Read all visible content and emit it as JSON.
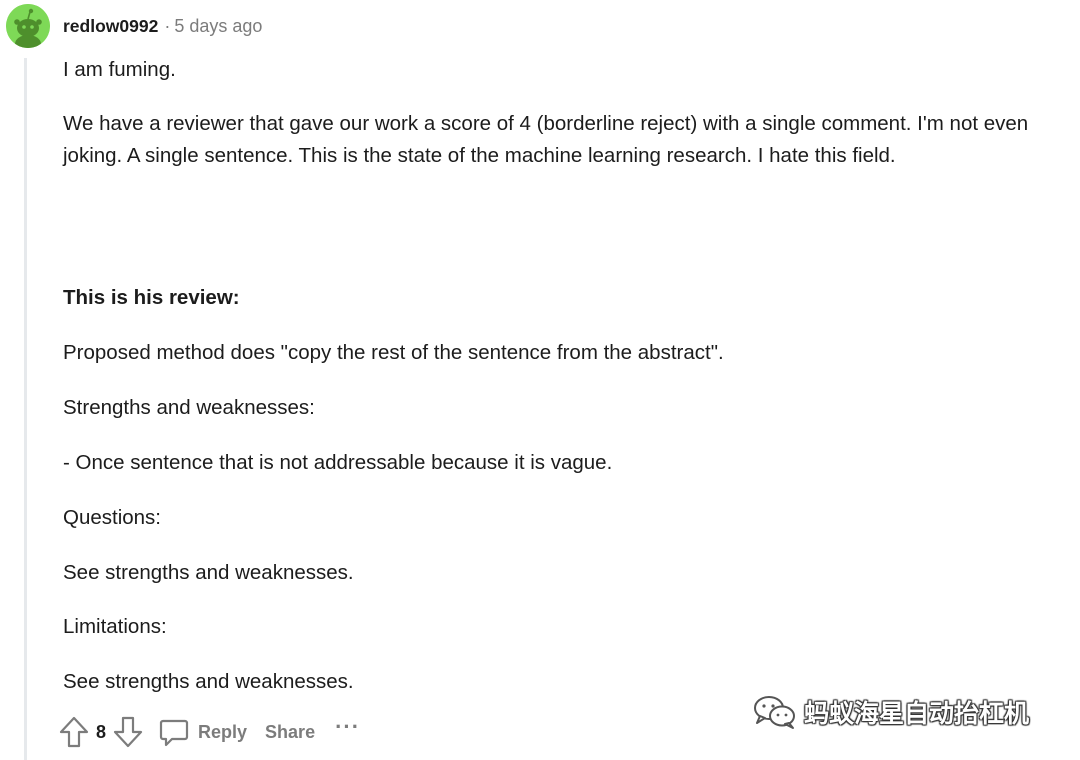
{
  "comment": {
    "username": "redlow0992",
    "separator": "·",
    "timestamp": "5 days ago",
    "paragraphs": [
      "I am fuming.",
      "We have a reviewer that gave our work a score of 4 (borderline reject) with a single comment. I'm not even joking. A single sentence. This is the state of the machine learning research. I hate this field.",
      "This is his review:",
      "Proposed method does \"copy the rest of the sentence from the abstract\".",
      "Strengths and weaknesses:",
      "- Once sentence that is not addressable because it is vague.",
      "Questions:",
      "See strengths and weaknesses.",
      "Limitations:",
      "See strengths and weaknesses."
    ]
  },
  "actions": {
    "upvote_icon": "upvote-arrow-icon",
    "vote_count": "8",
    "downvote_icon": "downvote-arrow-icon",
    "reply_icon": "speech-bubble-icon",
    "reply_label": "Reply",
    "share_label": "Share",
    "more_label": "···"
  },
  "watermark": {
    "icon": "wechat-icon",
    "text": "蚂蚁海星自动抬杠机"
  },
  "colors": {
    "avatar_bg": "#7ed957",
    "text": "#1c1c1c",
    "meta": "#7c7c7c",
    "thread_line": "#e6e9ec"
  }
}
